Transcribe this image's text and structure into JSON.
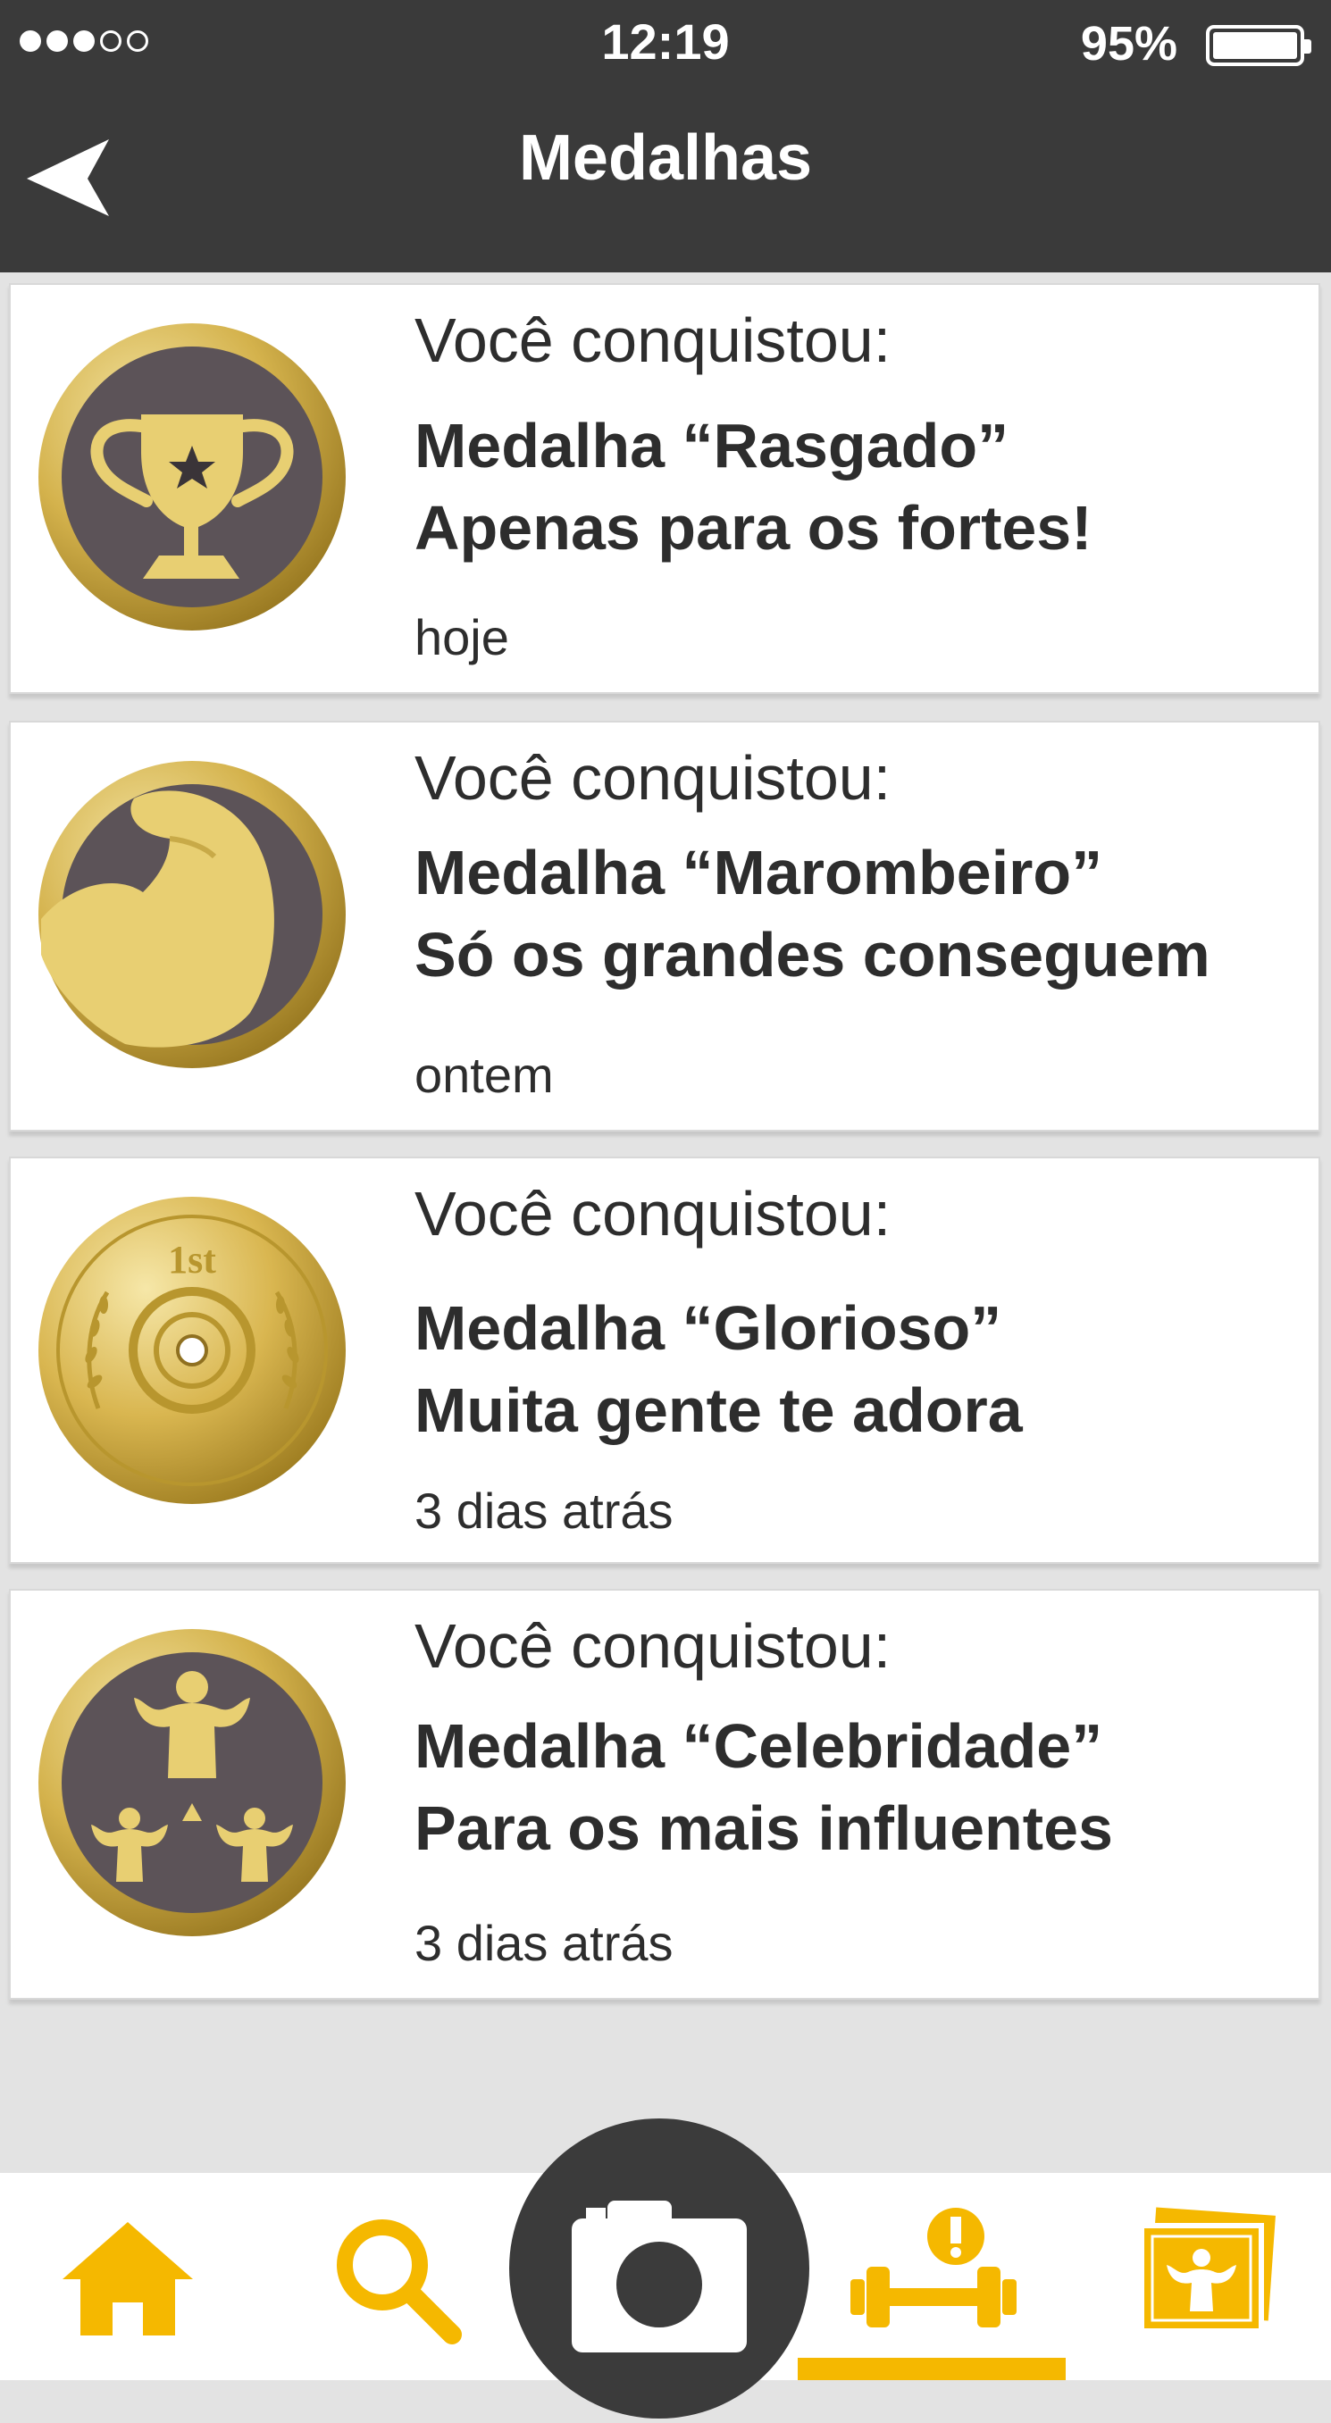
{
  "status_bar": {
    "signal_bars_filled": 3,
    "signal_bars_total": 5,
    "time": "12:19",
    "battery_percent": "95%"
  },
  "nav": {
    "title": "Medalhas",
    "back_icon": "back-arrow-icon"
  },
  "medals": [
    {
      "label": "Você conquistou:",
      "name": "Medalha “Rasgado”",
      "description": "Apenas para os fortes!",
      "time": "hoje",
      "icon": "trophy-icon"
    },
    {
      "label": "Você conquistou:",
      "name": "Medalha “Marombeiro”",
      "description": "Só os grandes conseguem",
      "time": "ontem",
      "icon": "flexed-arm-icon"
    },
    {
      "label": "Você conquistou:",
      "name": "Medalha “Glorioso”",
      "description": "Muita gente te adora",
      "time": "3 dias atrás",
      "icon": "weight-plate-laurel-icon",
      "badge_text": "1st"
    },
    {
      "label": "Você conquistou:",
      "name": "Medalha “Celebridade”",
      "description": "Para os mais influentes",
      "time": "3 dias atrás",
      "icon": "bodybuilders-icon"
    }
  ],
  "tab_bar": {
    "items": [
      {
        "icon": "home-icon"
      },
      {
        "icon": "search-icon"
      },
      {
        "icon": "camera-icon"
      },
      {
        "icon": "dumbbell-alert-icon",
        "active": true
      },
      {
        "icon": "gallery-muscle-icon"
      }
    ],
    "accent_color": "#f5b800",
    "bar_color": "#3a3a3a",
    "medal_gold": "#d4b24c",
    "medal_dark": "#5c5358"
  }
}
